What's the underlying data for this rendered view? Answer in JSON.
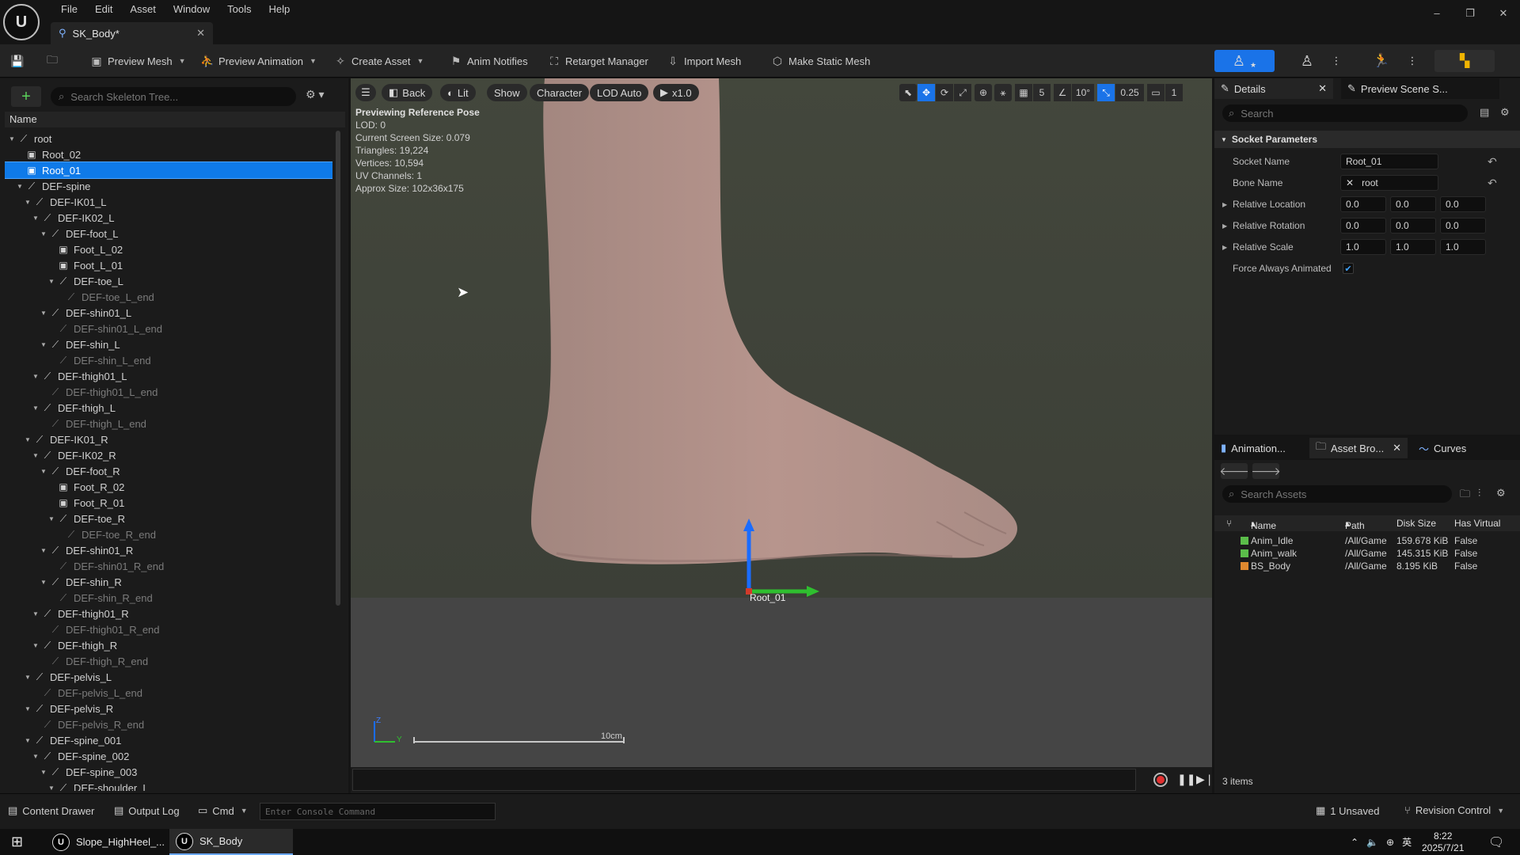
{
  "app": {
    "logo": "U",
    "menu": [
      "File",
      "Edit",
      "Asset",
      "Window",
      "Tools",
      "Help"
    ],
    "doc_tab": "SK_Body*",
    "window_controls": [
      "–",
      "❐",
      "✕"
    ]
  },
  "toolbar": {
    "preview_mesh": "Preview Mesh",
    "preview_animation": "Preview Animation",
    "create_asset": "Create Asset",
    "anim_notifies": "Anim Notifies",
    "retarget_manager": "Retarget Manager",
    "import_mesh": "Import Mesh",
    "make_static_mesh": "Make Static Mesh"
  },
  "skeleton": {
    "search_placeholder": "Search Skeleton Tree...",
    "column_name": "Name",
    "rows": [
      {
        "label": "root",
        "depth": 0,
        "kind": "bone",
        "exp": true
      },
      {
        "label": "Root_02",
        "depth": 1,
        "kind": "socket"
      },
      {
        "label": "Root_01",
        "depth": 1,
        "kind": "socket",
        "sel": true
      },
      {
        "label": "DEF-spine",
        "depth": 1,
        "kind": "bone",
        "exp": true
      },
      {
        "label": "DEF-IK01_L",
        "depth": 2,
        "kind": "bone",
        "exp": true
      },
      {
        "label": "DEF-IK02_L",
        "depth": 3,
        "kind": "bone",
        "exp": true
      },
      {
        "label": "DEF-foot_L",
        "depth": 4,
        "kind": "bone",
        "exp": true
      },
      {
        "label": "Foot_L_02",
        "depth": 5,
        "kind": "socket"
      },
      {
        "label": "Foot_L_01",
        "depth": 5,
        "kind": "socket"
      },
      {
        "label": "DEF-toe_L",
        "depth": 5,
        "kind": "bone",
        "exp": true
      },
      {
        "label": "DEF-toe_L_end",
        "depth": 6,
        "kind": "bone",
        "dim": true
      },
      {
        "label": "DEF-shin01_L",
        "depth": 4,
        "kind": "bone",
        "exp": true
      },
      {
        "label": "DEF-shin01_L_end",
        "depth": 5,
        "kind": "bone",
        "dim": true
      },
      {
        "label": "DEF-shin_L",
        "depth": 4,
        "kind": "bone",
        "exp": true
      },
      {
        "label": "DEF-shin_L_end",
        "depth": 5,
        "kind": "bone",
        "dim": true
      },
      {
        "label": "DEF-thigh01_L",
        "depth": 3,
        "kind": "bone",
        "exp": true
      },
      {
        "label": "DEF-thigh01_L_end",
        "depth": 4,
        "kind": "bone",
        "dim": true
      },
      {
        "label": "DEF-thigh_L",
        "depth": 3,
        "kind": "bone",
        "exp": true
      },
      {
        "label": "DEF-thigh_L_end",
        "depth": 4,
        "kind": "bone",
        "dim": true
      },
      {
        "label": "DEF-IK01_R",
        "depth": 2,
        "kind": "bone",
        "exp": true
      },
      {
        "label": "DEF-IK02_R",
        "depth": 3,
        "kind": "bone",
        "exp": true
      },
      {
        "label": "DEF-foot_R",
        "depth": 4,
        "kind": "bone",
        "exp": true
      },
      {
        "label": "Foot_R_02",
        "depth": 5,
        "kind": "socket"
      },
      {
        "label": "Foot_R_01",
        "depth": 5,
        "kind": "socket"
      },
      {
        "label": "DEF-toe_R",
        "depth": 5,
        "kind": "bone",
        "exp": true
      },
      {
        "label": "DEF-toe_R_end",
        "depth": 6,
        "kind": "bone",
        "dim": true
      },
      {
        "label": "DEF-shin01_R",
        "depth": 4,
        "kind": "bone",
        "exp": true
      },
      {
        "label": "DEF-shin01_R_end",
        "depth": 5,
        "kind": "bone",
        "dim": true
      },
      {
        "label": "DEF-shin_R",
        "depth": 4,
        "kind": "bone",
        "exp": true
      },
      {
        "label": "DEF-shin_R_end",
        "depth": 5,
        "kind": "bone",
        "dim": true
      },
      {
        "label": "DEF-thigh01_R",
        "depth": 3,
        "kind": "bone",
        "exp": true
      },
      {
        "label": "DEF-thigh01_R_end",
        "depth": 4,
        "kind": "bone",
        "dim": true
      },
      {
        "label": "DEF-thigh_R",
        "depth": 3,
        "kind": "bone",
        "exp": true
      },
      {
        "label": "DEF-thigh_R_end",
        "depth": 4,
        "kind": "bone",
        "dim": true
      },
      {
        "label": "DEF-pelvis_L",
        "depth": 2,
        "kind": "bone",
        "exp": true
      },
      {
        "label": "DEF-pelvis_L_end",
        "depth": 3,
        "kind": "bone",
        "dim": true
      },
      {
        "label": "DEF-pelvis_R",
        "depth": 2,
        "kind": "bone",
        "exp": true
      },
      {
        "label": "DEF-pelvis_R_end",
        "depth": 3,
        "kind": "bone",
        "dim": true
      },
      {
        "label": "DEF-spine_001",
        "depth": 2,
        "kind": "bone",
        "exp": true
      },
      {
        "label": "DEF-spine_002",
        "depth": 3,
        "kind": "bone",
        "exp": true
      },
      {
        "label": "DEF-spine_003",
        "depth": 4,
        "kind": "bone",
        "exp": true
      },
      {
        "label": "DEF-shoulder_L",
        "depth": 5,
        "kind": "bone",
        "exp": true
      }
    ]
  },
  "viewport": {
    "back": "Back",
    "lit": "Lit",
    "show": "Show",
    "character": "Character",
    "lod": "LOD Auto",
    "speed": "x1.0",
    "grid_size": "5",
    "angle_snap": "10°",
    "scale_snap": "0.25",
    "camera_speed": "1",
    "info": [
      "Previewing Reference Pose",
      "LOD: 0",
      "Current Screen Size: 0.079",
      "Triangles: 19,224",
      "Vertices: 10,594",
      "UV Channels: 1",
      "Approx Size: 102x36x175"
    ],
    "socket_label": "Root_01",
    "scale_label": "10cm",
    "axis_z": "Z",
    "axis_y": "Y"
  },
  "details": {
    "tab": "Details",
    "tab2": "Preview Scene S...",
    "search_placeholder": "Search",
    "section": "Socket Parameters",
    "socket_name_label": "Socket Name",
    "socket_name": "Root_01",
    "bone_name_label": "Bone Name",
    "bone_name": "root",
    "relative_location_label": "Relative Location",
    "relative_location": [
      "0.0",
      "0.0",
      "0.0"
    ],
    "relative_rotation_label": "Relative Rotation",
    "relative_rotation": [
      "0.0",
      "0.0",
      "0.0"
    ],
    "relative_scale_label": "Relative Scale",
    "relative_scale": [
      "1.0",
      "1.0",
      "1.0"
    ],
    "force_animated_label": "Force Always Animated",
    "force_animated": true
  },
  "assets": {
    "tabs": [
      "Animation...",
      "Asset Bro...",
      "Curves"
    ],
    "search_placeholder": "Search Assets",
    "columns": [
      "Name",
      "Path",
      "Disk Size",
      "Has Virtual"
    ],
    "rows": [
      {
        "name": "Anim_Idle",
        "path": "/All/Game",
        "size": "159.678 KiB",
        "virtual": "False",
        "color": "#5bbd4a"
      },
      {
        "name": "Anim_walk",
        "path": "/All/Game",
        "size": "145.315 KiB",
        "virtual": "False",
        "color": "#5bbd4a"
      },
      {
        "name": "BS_Body",
        "path": "/All/Game",
        "size": "8.195 KiB",
        "virtual": "False",
        "color": "#e0892f"
      }
    ],
    "count": "3 items"
  },
  "status": {
    "content_drawer": "Content Drawer",
    "output_log": "Output Log",
    "cmd": "Cmd",
    "console_placeholder": "Enter Console Command",
    "unsaved": "1 Unsaved",
    "revision": "Revision Control"
  },
  "taskbar": {
    "item1": "Slope_HighHeel_...",
    "item2": "SK_Body",
    "time": "8:22",
    "date": "2025/7/21",
    "ime": "英"
  },
  "colors": {
    "accent": "#0f7ae8",
    "selection": "#0f7ae8",
    "play_active": "#1a73e8"
  }
}
